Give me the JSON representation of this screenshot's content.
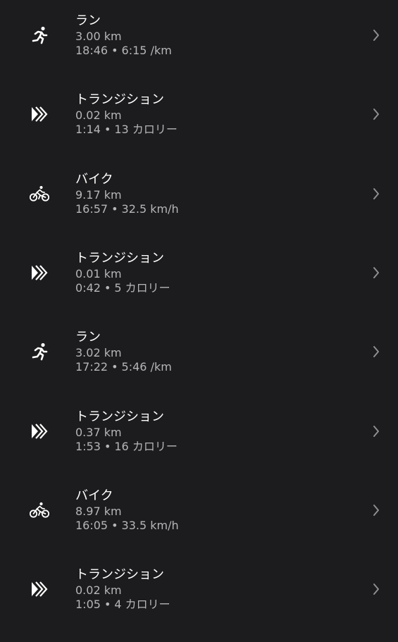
{
  "theme": {
    "background": "#1c1c1e",
    "primary_text": "#ffffff",
    "secondary_text": "#b6b6ba",
    "chevron": "#8e8e93"
  },
  "separator": "•",
  "segments": [
    {
      "icon": "run-icon",
      "type": "ラン",
      "distance": "3.00 km",
      "time": "18:46",
      "metric": "6:15 /km"
    },
    {
      "icon": "transition-icon",
      "type": "トランジション",
      "distance": "0.02 km",
      "time": "1:14",
      "metric": "13 カロリー"
    },
    {
      "icon": "bike-icon",
      "type": "バイク",
      "distance": "9.17 km",
      "time": "16:57",
      "metric": "32.5 km/h"
    },
    {
      "icon": "transition-icon",
      "type": "トランジション",
      "distance": "0.01 km",
      "time": "0:42",
      "metric": "5 カロリー"
    },
    {
      "icon": "run-icon",
      "type": "ラン",
      "distance": "3.02 km",
      "time": "17:22",
      "metric": "5:46 /km"
    },
    {
      "icon": "transition-icon",
      "type": "トランジション",
      "distance": "0.37 km",
      "time": "1:53",
      "metric": "16 カロリー"
    },
    {
      "icon": "bike-icon",
      "type": "バイク",
      "distance": "8.97 km",
      "time": "16:05",
      "metric": "33.5 km/h"
    },
    {
      "icon": "transition-icon",
      "type": "トランジション",
      "distance": "0.02 km",
      "time": "1:05",
      "metric": "4 カロリー"
    }
  ]
}
